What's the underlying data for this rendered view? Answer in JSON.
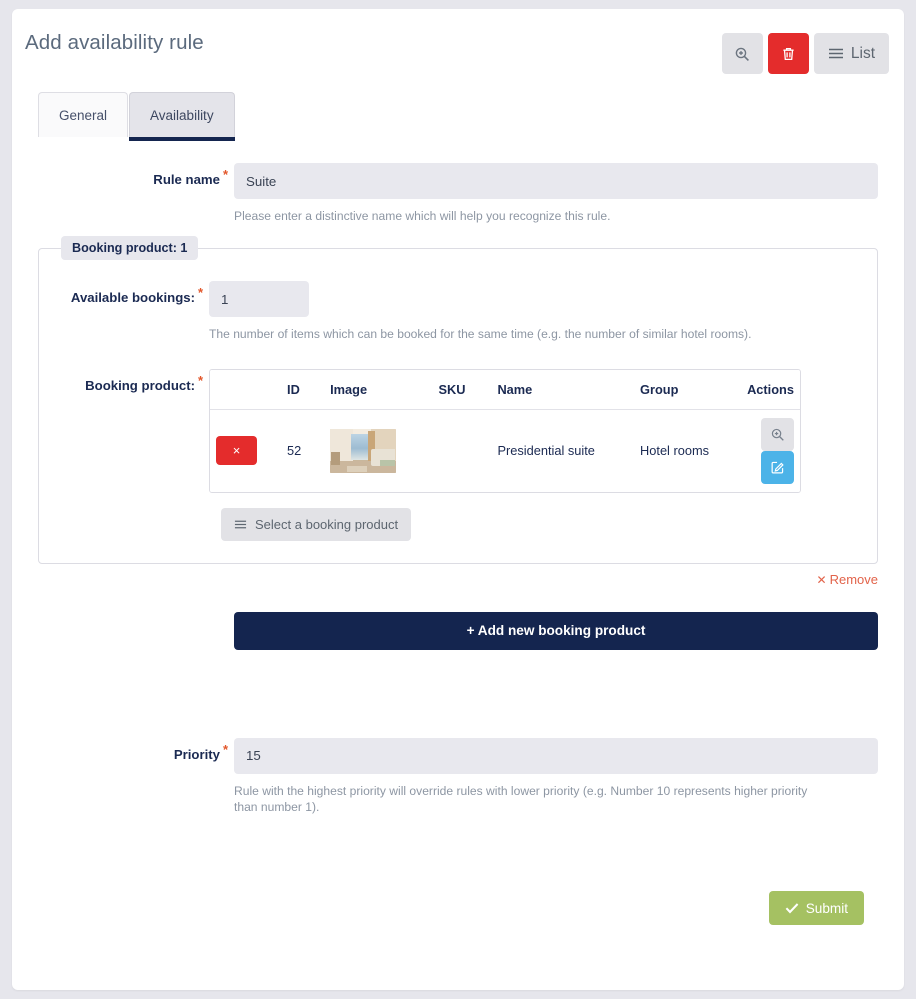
{
  "header": {
    "title": "Add availability rule",
    "toolbar": [
      {
        "name": "zoom-in-button",
        "icon": "magnifier-plus-icon",
        "label": ""
      },
      {
        "name": "delete-button",
        "icon": "trash-icon",
        "label": ""
      },
      {
        "name": "list-button",
        "icon": "hamburger-icon",
        "label": "List"
      }
    ]
  },
  "tabs": [
    {
      "label": "General",
      "active": false
    },
    {
      "label": "Availability",
      "active": true
    }
  ],
  "form": {
    "rule_name": {
      "label": "Rule name",
      "required": "*",
      "value": "Suite",
      "placeholder": "",
      "help": "Please enter a distinctive name which will help you recognize this rule."
    },
    "booking_product_group": {
      "legend": "Booking product: 1",
      "available_bookings": {
        "label": "Available bookings:",
        "required": "*",
        "value": "1",
        "placeholder": "",
        "help": "The number of items which can be booked for the same time (e.g. the number of similar hotel rooms)."
      },
      "booking_product": {
        "label": "Booking product:",
        "required": "*",
        "columns": [
          "",
          "ID",
          "Image",
          "SKU",
          "Name",
          "Group",
          "Actions"
        ],
        "rows": [
          {
            "delete_label": "×",
            "id": "52",
            "image_alt": "hotel-room-thumbnail",
            "sku": "",
            "name": "Presidential suite",
            "group": "Hotel rooms",
            "actions": [
              {
                "name": "view-product-button",
                "icon": "magnifier-plus-icon"
              },
              {
                "name": "edit-product-button",
                "icon": "pencil-square-icon"
              }
            ]
          }
        ],
        "select_button": "Select a booking product"
      },
      "remove_label": "Remove",
      "remove_icon": "✕"
    },
    "add_new_booking_product": "+ Add new booking product",
    "priority": {
      "label": "Priority",
      "required": "*",
      "value": "15",
      "placeholder": "",
      "help": "Rule with the highest priority will override rules with lower priority (e.g. Number 10 represents higher priority than number 1)."
    },
    "submit": {
      "label": "Submit",
      "icon": "check-icon"
    }
  },
  "colors": {
    "page_background": "#e6e6ec",
    "card": "#ffffff",
    "primary_navy": "#14254f",
    "danger_red": "#e42c2c",
    "info_blue": "#4cb3e8",
    "success_green": "#a5c162",
    "required_orange": "#e2572b",
    "remove_link": "#e2634a",
    "input_background": "#e8e8ee",
    "muted_text": "#8d96a3"
  }
}
